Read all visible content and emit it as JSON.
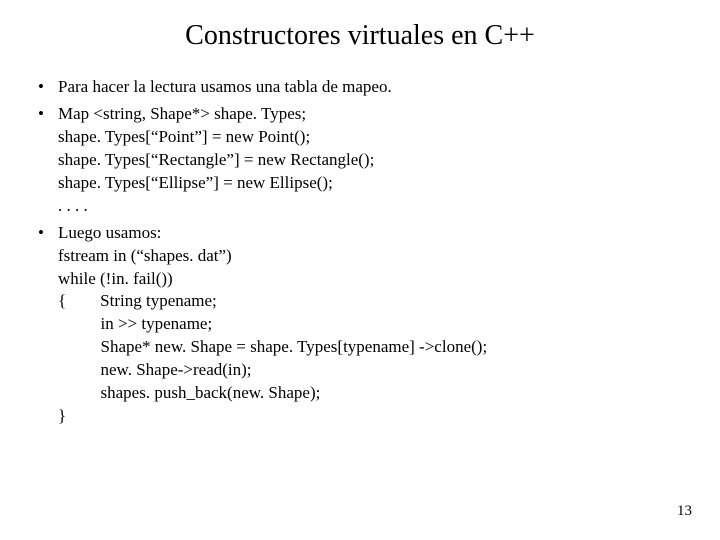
{
  "title": "Constructores virtuales en C++",
  "bullets": [
    {
      "text": "Para hacer la lectura usamos una tabla de mapeo."
    },
    {
      "text": "Map <string, Shape*> shape. Types;\nshape. Types[“Point”] = new Point();\nshape. Types[“Rectangle”] = new Rectangle();\nshape. Types[“Ellipse”] = new Ellipse();\n. . . ."
    },
    {
      "text": "Luego usamos:\nfstream in (“shapes. dat”)\nwhile (!in. fail())\n{        String typename;\n          in >> typename;\n          Shape* new. Shape = shape. Types[typename] ->clone();\n          new. Shape->read(in);\n          shapes. push_back(new. Shape);\n}"
    }
  ],
  "page_number": "13"
}
